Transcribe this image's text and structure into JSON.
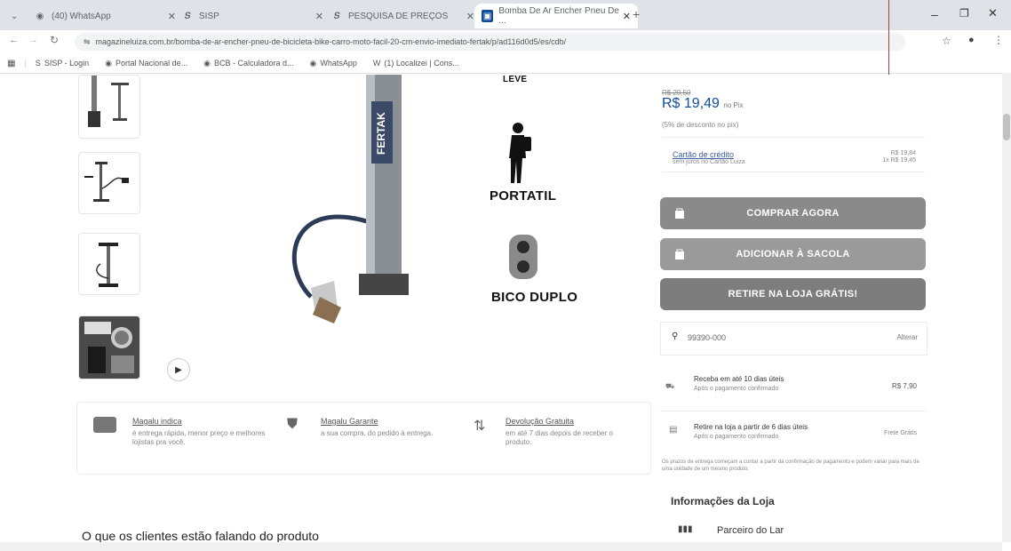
{
  "browser": {
    "tabs": [
      {
        "title": "(40) WhatsApp",
        "active": false
      },
      {
        "title": "SISP",
        "active": false
      },
      {
        "title": "PESQUISA DE PREÇOS",
        "active": false
      },
      {
        "title": "Bomba De Ar Encher Pneu De ...",
        "active": true
      }
    ],
    "new_tab": "+",
    "url": "magazineluiza.com.br/bomba-de-ar-encher-pneu-de-bicicleta-bike-carro-moto-facil-20-cm-envio-imediato-fertak/p/ad116d0d5/es/cdb/",
    "bookmarks": [
      {
        "icon": "S",
        "label": "SISP - Login"
      },
      {
        "icon": "◉",
        "label": "Portal Nacional de..."
      },
      {
        "icon": "◉",
        "label": "BCB - Calculadora d..."
      },
      {
        "icon": "◉",
        "label": "WhatsApp"
      },
      {
        "icon": "W",
        "label": "(1) Localizei | Cons..."
      }
    ]
  },
  "product": {
    "features": [
      "LEVE",
      "PORTATIL",
      "BICO DUPLO"
    ],
    "brand_text": "FERTAK"
  },
  "pricing": {
    "old_price": "R$ 20,50",
    "price": "R$ 19,49",
    "price_suffix": "no Pix",
    "discount_note": "(5% de desconto no pix)",
    "card_label": "Cartão de crédito",
    "card_sub": "sem juros no Cartão Luiza",
    "card_price": "R$ 19,84",
    "card_installments": "1x R$ 19,45"
  },
  "buttons": {
    "buy_now": "COMPRAR AGORA",
    "add_bag": "ADICIONAR À SACOLA",
    "pickup": "RETIRE NA LOJA GRÁTIS!"
  },
  "shipping": {
    "cep": "99390-000",
    "change": "Alterar",
    "delivery_title": "Receba em até 10 dias úteis",
    "delivery_sub": "Após o pagamento confirmado",
    "delivery_price": "R$ 7,90",
    "pickup_title": "Retire na loja a partir de 6 dias úteis",
    "pickup_sub": "Após o pagamento confirmado",
    "pickup_price": "Frete Grátis",
    "note": "Os prazos de entrega começam a contar a partir da confirmação de pagamento e podem variar para mais de uma unidade de um mesmo produto."
  },
  "store": {
    "heading": "Informações da Loja",
    "name": "Parceiro do Lar"
  },
  "benefits": [
    {
      "title": "Magalu indica",
      "desc": "é entrega rápida, menor preço e melhores lojistas pra você."
    },
    {
      "title": "Magalu Garante",
      "desc": "a sua compra, do pedido à entrega."
    },
    {
      "title": "Devolução Gratuita",
      "desc": "em até 7 dias depois de receber o produto."
    }
  ],
  "reviews_heading": "O que os clientes estão falando do produto",
  "colors": {
    "buy_btn": "#8a8a8a",
    "bag_btn": "#9a9a9a",
    "pickup_btn": "#7d7d7d",
    "accent_blue": "#0f4c9c"
  }
}
